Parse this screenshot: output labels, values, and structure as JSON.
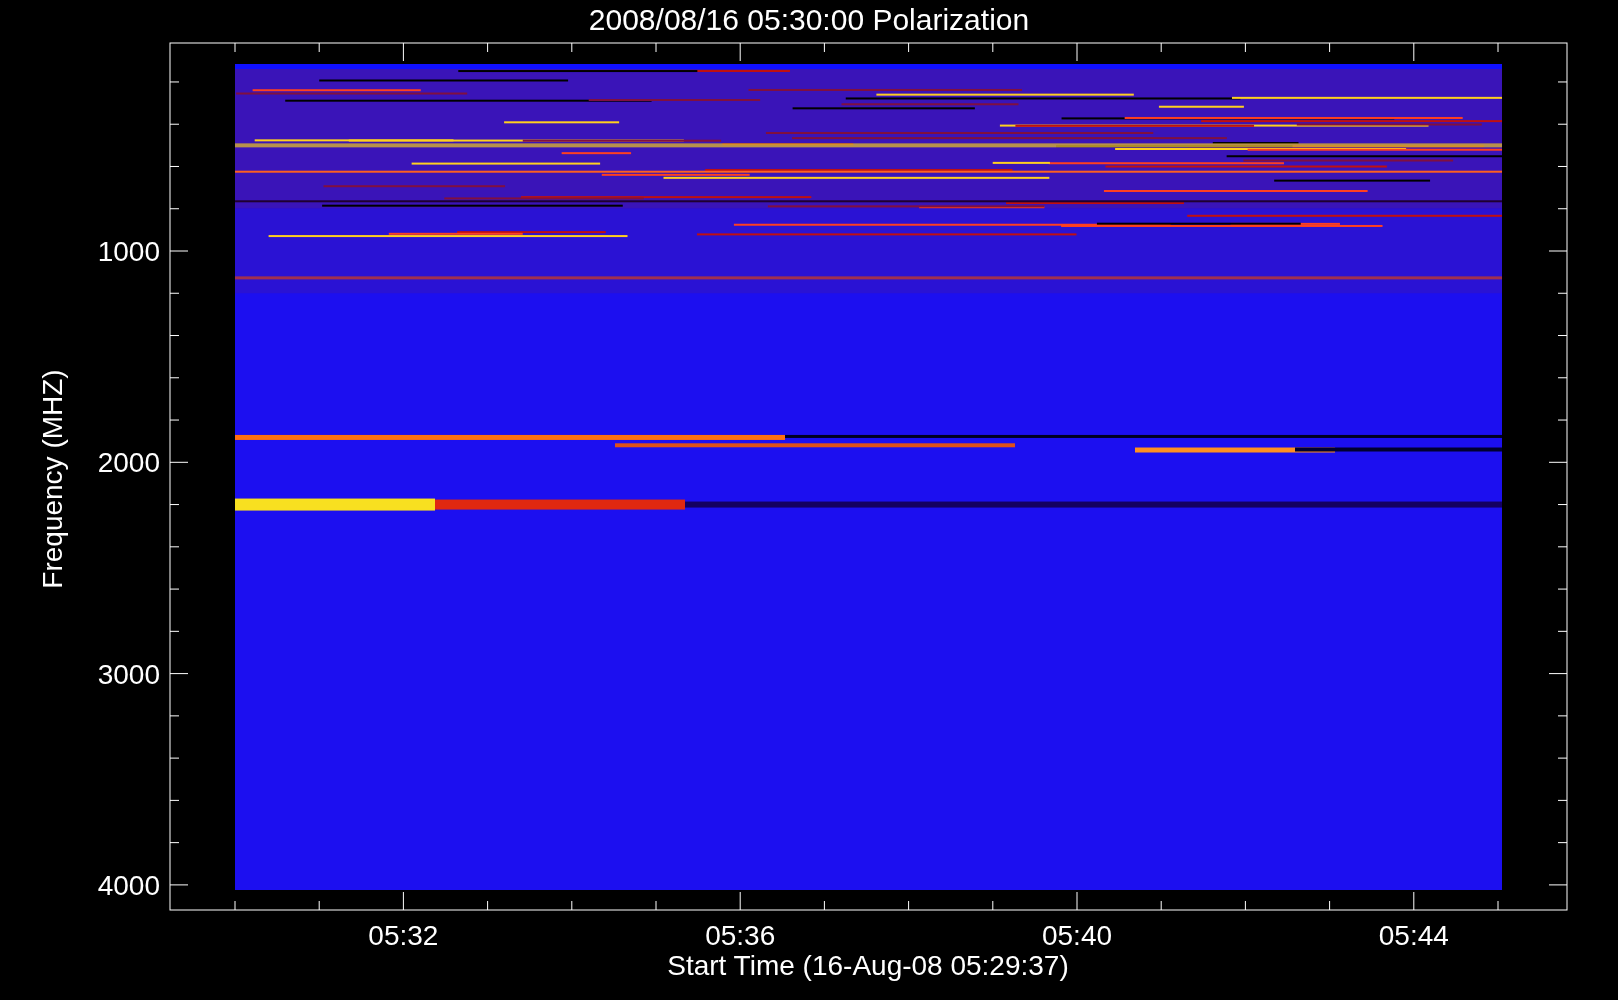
{
  "plot": {
    "title": "2008/08/16 05:30:00 Polarization",
    "ylabel": "Frequency (MHZ)",
    "xlabel": "Start Time (16-Aug-08 05:29:37)",
    "yticks": [
      "1000",
      "2000",
      "3000",
      "4000"
    ],
    "xticks": [
      "05:32",
      "05:36",
      "05:40",
      "05:44"
    ]
  }
}
